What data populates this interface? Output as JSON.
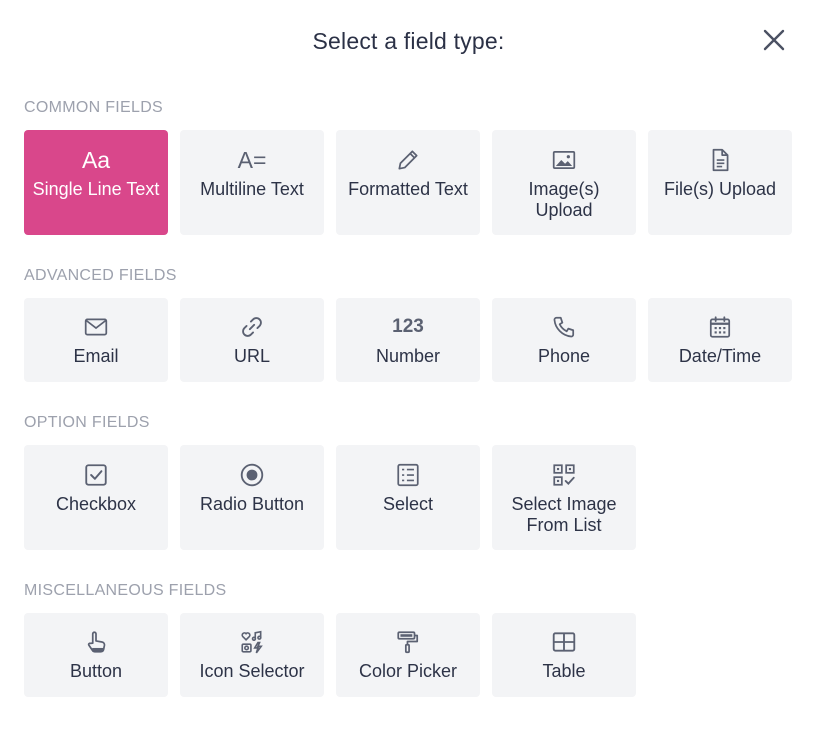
{
  "title": "Select a field type:",
  "colors": {
    "accent": "#d9478b",
    "tile_bg": "#f3f4f6",
    "heading": "#9da1ad",
    "text": "#2d3347"
  },
  "sections": {
    "common": {
      "heading": "COMMON FIELDS",
      "items": [
        {
          "label": "Single Line Text",
          "icon": "text-aa-icon",
          "selected": true
        },
        {
          "label": "Multiline Text",
          "icon": "multiline-text-icon"
        },
        {
          "label": "Formatted Text",
          "icon": "pencil-icon"
        },
        {
          "label": "Image(s) Upload",
          "icon": "image-icon"
        },
        {
          "label": "File(s) Upload",
          "icon": "file-icon"
        }
      ]
    },
    "advanced": {
      "heading": "ADVANCED FIELDS",
      "items": [
        {
          "label": "Email",
          "icon": "envelope-icon"
        },
        {
          "label": "URL",
          "icon": "link-icon"
        },
        {
          "label": "Number",
          "icon": "number-123-icon"
        },
        {
          "label": "Phone",
          "icon": "phone-icon"
        },
        {
          "label": "Date/Time",
          "icon": "calendar-icon"
        }
      ]
    },
    "option": {
      "heading": "OPTION FIELDS",
      "items": [
        {
          "label": "Checkbox",
          "icon": "checkbox-icon"
        },
        {
          "label": "Radio Button",
          "icon": "radio-icon"
        },
        {
          "label": "Select",
          "icon": "select-list-icon"
        },
        {
          "label": "Select Image From List",
          "icon": "image-list-icon"
        }
      ]
    },
    "misc": {
      "heading": "MISCELLANEOUS FIELDS",
      "items": [
        {
          "label": "Button",
          "icon": "pointer-hand-icon"
        },
        {
          "label": "Icon Selector",
          "icon": "icon-selector-icon"
        },
        {
          "label": "Color Picker",
          "icon": "paint-roller-icon"
        },
        {
          "label": "Table",
          "icon": "table-icon"
        }
      ]
    }
  },
  "glyphs": {
    "aa": "Aa",
    "a_eq": "A=",
    "n123": "123"
  }
}
